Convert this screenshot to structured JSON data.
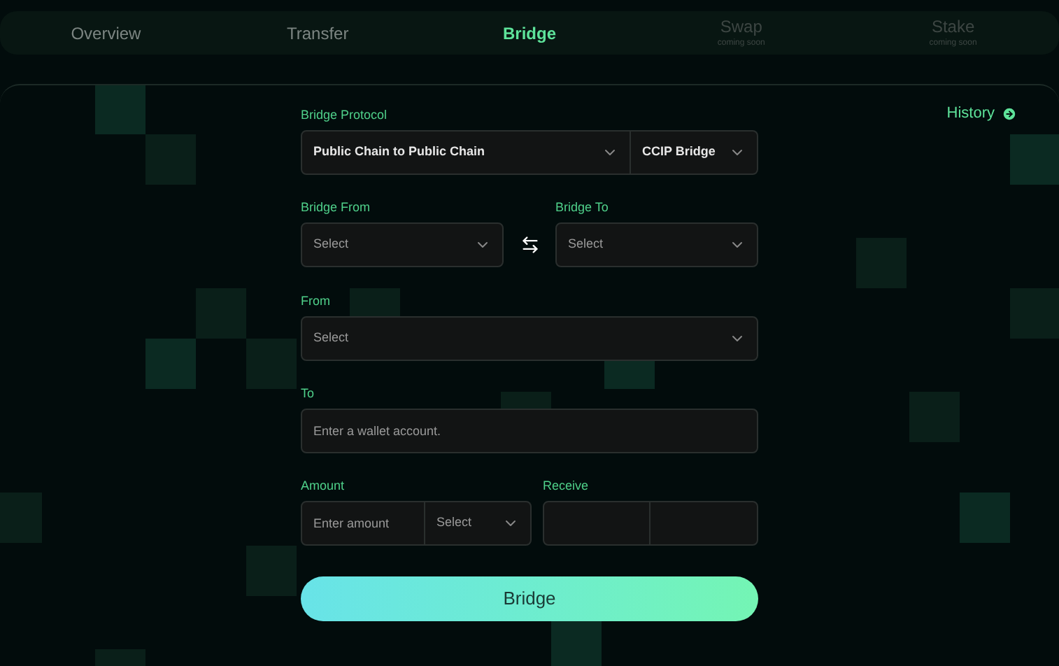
{
  "tabs": [
    {
      "label": "Overview",
      "selected": false,
      "disabled": false
    },
    {
      "label": "Transfer",
      "selected": false,
      "disabled": false
    },
    {
      "label": "Bridge",
      "selected": true,
      "disabled": false
    },
    {
      "label": "Swap",
      "selected": false,
      "disabled": true,
      "note": "coming soon"
    },
    {
      "label": "Stake",
      "selected": false,
      "disabled": true,
      "note": "coming soon"
    }
  ],
  "history_link": "History",
  "protocol": {
    "label": "Bridge Protocol",
    "route": "Public Chain to Public Chain",
    "bridge": "CCIP Bridge"
  },
  "bridge_from": {
    "label": "Bridge From",
    "value": "Select"
  },
  "bridge_to": {
    "label": "Bridge To",
    "value": "Select"
  },
  "from": {
    "label": "From",
    "value": "Select"
  },
  "to": {
    "label": "To",
    "placeholder": "Enter a wallet account."
  },
  "amount": {
    "label": "Amount",
    "placeholder": "Enter amount",
    "token": "Select"
  },
  "receive": {
    "label": "Receive"
  },
  "submit": "Bridge"
}
